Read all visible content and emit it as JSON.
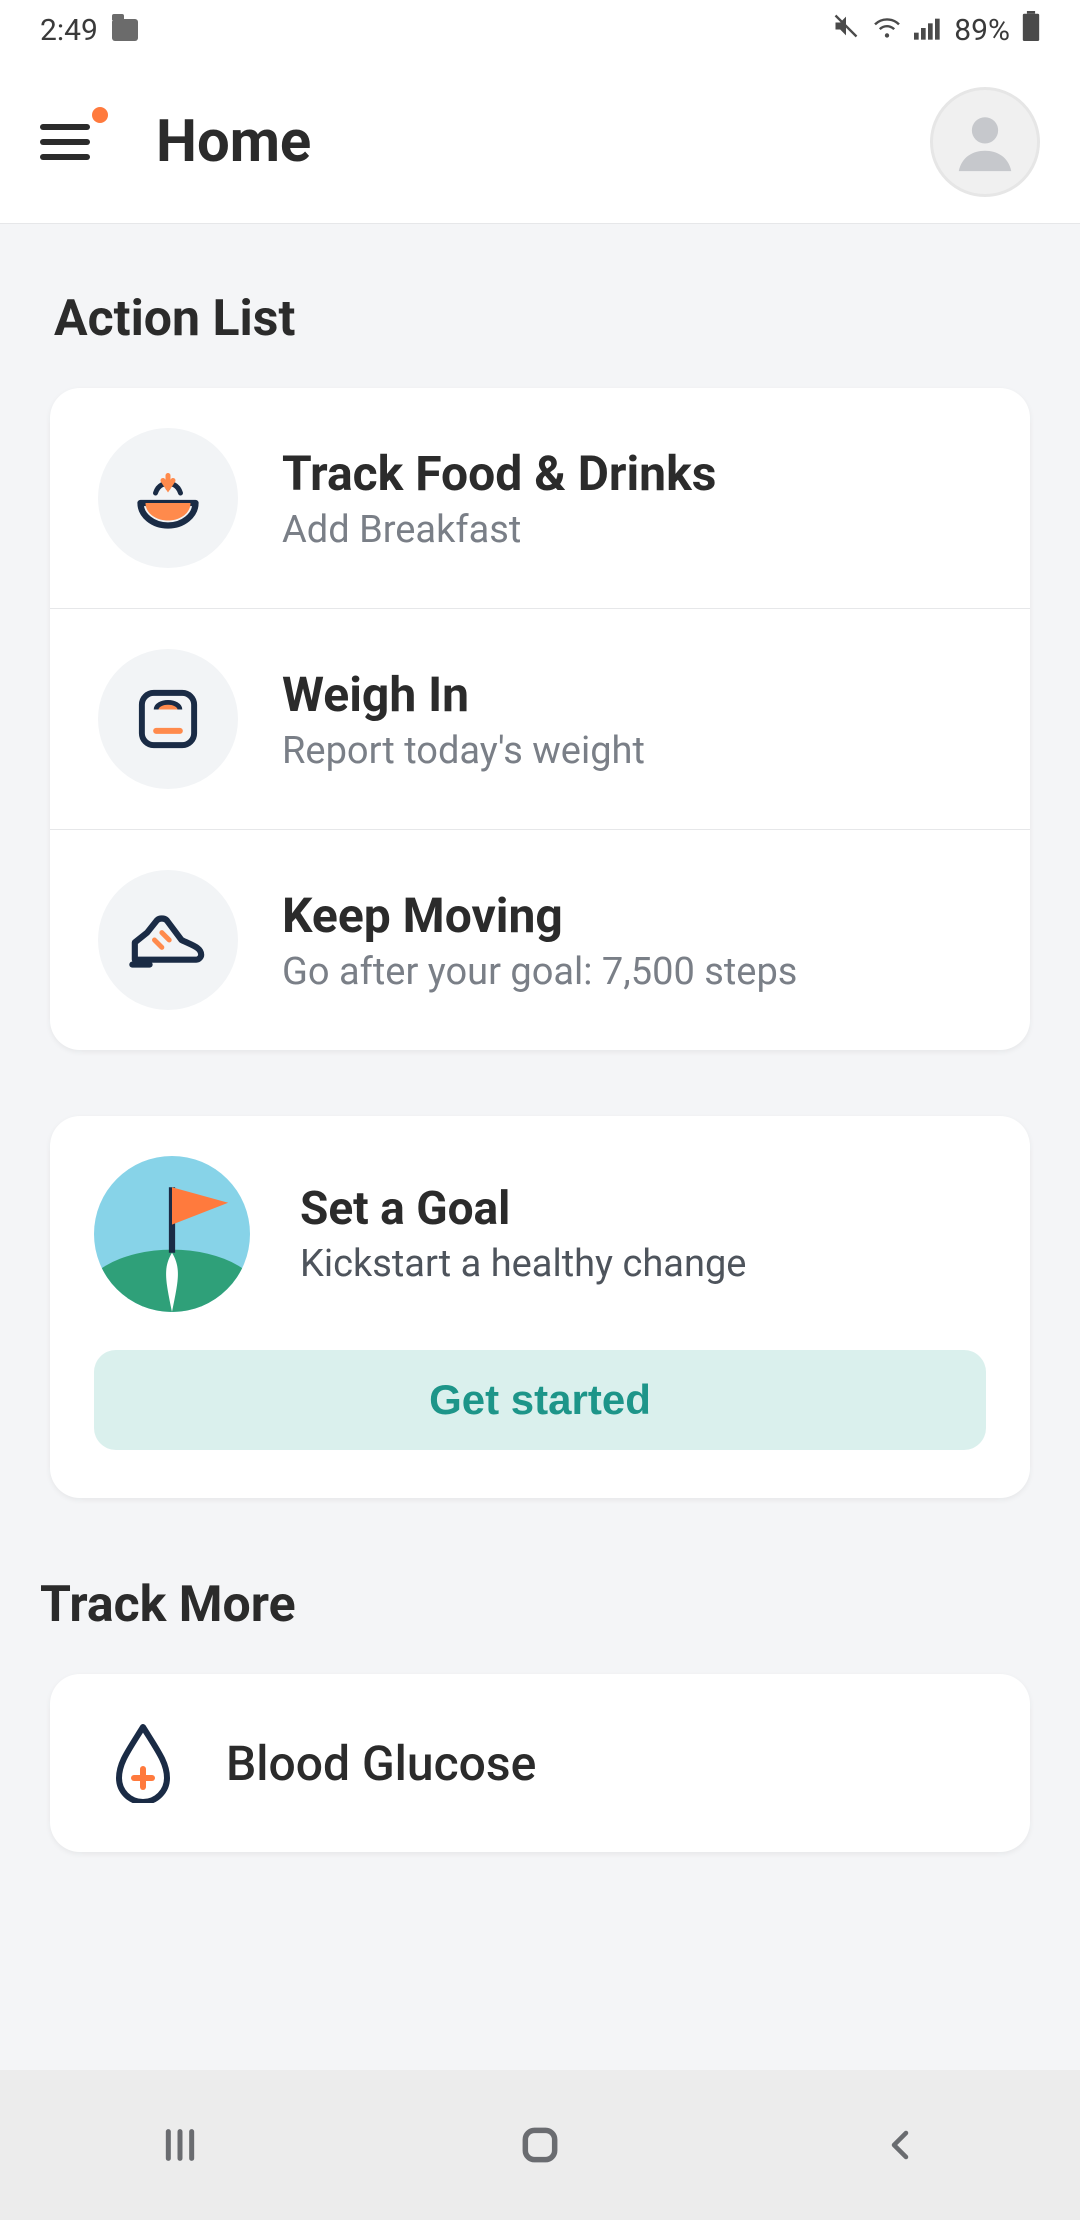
{
  "status": {
    "time": "2:49",
    "battery": "89%"
  },
  "header": {
    "title": "Home"
  },
  "sections": {
    "action_list": "Action List",
    "track_more": "Track More"
  },
  "actions": [
    {
      "title": "Track Food & Drinks",
      "sub": "Add Breakfast"
    },
    {
      "title": "Weigh In",
      "sub": "Report today's weight"
    },
    {
      "title": "Keep Moving",
      "sub": "Go after your goal: 7,500 steps"
    }
  ],
  "goal": {
    "title": "Set a Goal",
    "sub": "Kickstart a healthy change",
    "button": "Get started"
  },
  "track_more_items": [
    {
      "title": "Blood Glucose"
    }
  ]
}
